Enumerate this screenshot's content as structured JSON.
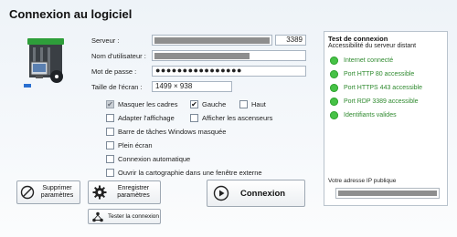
{
  "title": "Connexion au logiciel",
  "form": {
    "server_label": "Serveur :",
    "port": "3389",
    "user_label": "Nom d'utilisateur :",
    "password_label": "Mot de passe :",
    "password": "●●●●●●●●●●●●●●●●",
    "screen_label": "Taille de l'écran :",
    "screen_size": "1499 × 938"
  },
  "options": {
    "hide_frames": "Masquer les cadres",
    "left": "Gauche",
    "top": "Haut",
    "adapt_display": "Adapter l'affichage",
    "show_scrollbars": "Afficher les ascenseurs",
    "taskbar": "Barre de tâches Windows masquée",
    "fullscreen": "Plein écran",
    "auto_connect": "Connexion automatique",
    "open_map": "Ouvrir la cartographie dans une fenêtre externe"
  },
  "checks": {
    "hide_frames": true,
    "left": true,
    "top": false,
    "adapt_display": false,
    "show_scrollbars": false,
    "taskbar": false,
    "fullscreen": false,
    "auto_connect": false,
    "open_map": false
  },
  "panel": {
    "title": "Test de connexion",
    "subtitle": "Accessibilité du serveur distant",
    "items": [
      "Internet connecté",
      "Port HTTP 80 accessible",
      "Port HTTPS 443 accessible",
      "Port RDP 3389 accessible",
      "Identifiants valides"
    ],
    "status_color": "#46c246",
    "ip_label": "Votre adresse IP publique"
  },
  "buttons": {
    "delete": "Supprimer\nparamètres",
    "save": "Enregistrer\nparamètres",
    "connect": "Connexion",
    "test": "Tester la connexion"
  }
}
